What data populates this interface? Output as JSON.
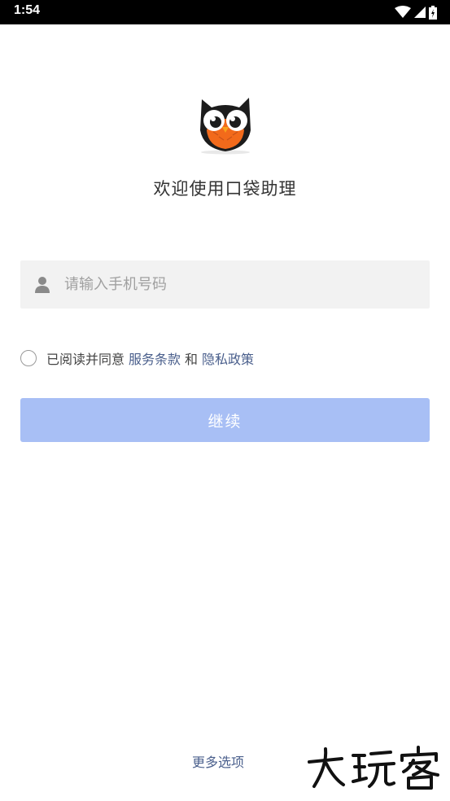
{
  "status_bar": {
    "time": "1:54"
  },
  "welcome": "欢迎使用口袋助理",
  "phone": {
    "placeholder": "请输入手机号码",
    "value": ""
  },
  "agreement": {
    "prefix": "已阅读并同意",
    "terms_link": "服务条款",
    "and": "和",
    "privacy_link": "隐私政策"
  },
  "continue_label": "继续",
  "more_options": "更多选项",
  "watermark_text": "大玩客",
  "colors": {
    "button": "#a8bff5",
    "link": "#4a5f8c",
    "owl_orange": "#f26a1b"
  }
}
